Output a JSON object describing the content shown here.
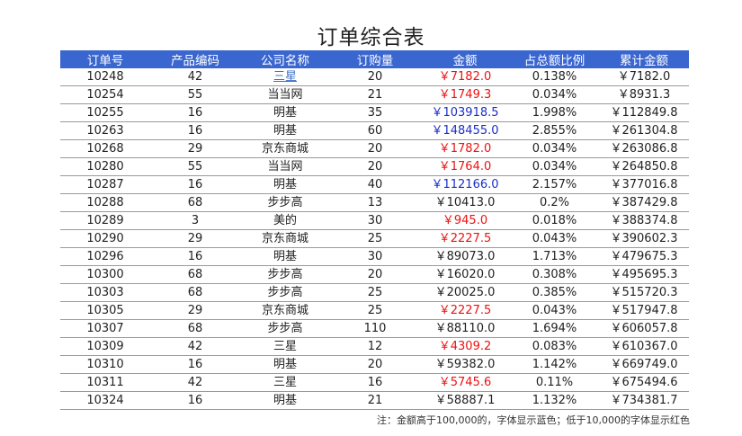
{
  "title": "订单综合表",
  "colors": {
    "header_bg": "#3a66cf",
    "low_amount": "#ee1111",
    "high_amount": "#1a2fc8",
    "link": "#3a6fc8"
  },
  "columns": [
    "订单号",
    "产品编码",
    "公司名称",
    "订购量",
    "金额",
    "占总额比例",
    "累计金额"
  ],
  "rows": [
    {
      "order": "10248",
      "code": "42",
      "company": "三星",
      "qty": "20",
      "amount": "￥7182.0",
      "amount_color": "red",
      "ratio": "0.138%",
      "cumulative": "￥7182.0",
      "link": true
    },
    {
      "order": "10254",
      "code": "55",
      "company": "当当网",
      "qty": "21",
      "amount": "￥1749.3",
      "amount_color": "red",
      "ratio": "0.034%",
      "cumulative": "￥8931.3"
    },
    {
      "order": "10255",
      "code": "16",
      "company": "明基",
      "qty": "35",
      "amount": "￥103918.5",
      "amount_color": "blue",
      "ratio": "1.998%",
      "cumulative": "￥112849.8"
    },
    {
      "order": "10263",
      "code": "16",
      "company": "明基",
      "qty": "60",
      "amount": "￥148455.0",
      "amount_color": "blue",
      "ratio": "2.855%",
      "cumulative": "￥261304.8"
    },
    {
      "order": "10268",
      "code": "29",
      "company": "京东商城",
      "qty": "20",
      "amount": "￥1782.0",
      "amount_color": "red",
      "ratio": "0.034%",
      "cumulative": "￥263086.8"
    },
    {
      "order": "10280",
      "code": "55",
      "company": "当当网",
      "qty": "20",
      "amount": "￥1764.0",
      "amount_color": "red",
      "ratio": "0.034%",
      "cumulative": "￥264850.8"
    },
    {
      "order": "10287",
      "code": "16",
      "company": "明基",
      "qty": "40",
      "amount": "￥112166.0",
      "amount_color": "blue",
      "ratio": "2.157%",
      "cumulative": "￥377016.8"
    },
    {
      "order": "10288",
      "code": "68",
      "company": "步步高",
      "qty": "13",
      "amount": "￥10413.0",
      "amount_color": "normal",
      "ratio": "0.2%",
      "cumulative": "￥387429.8"
    },
    {
      "order": "10289",
      "code": "3",
      "company": "美的",
      "qty": "30",
      "amount": "￥945.0",
      "amount_color": "red",
      "ratio": "0.018%",
      "cumulative": "￥388374.8"
    },
    {
      "order": "10290",
      "code": "29",
      "company": "京东商城",
      "qty": "25",
      "amount": "￥2227.5",
      "amount_color": "red",
      "ratio": "0.043%",
      "cumulative": "￥390602.3"
    },
    {
      "order": "10296",
      "code": "16",
      "company": "明基",
      "qty": "30",
      "amount": "￥89073.0",
      "amount_color": "normal",
      "ratio": "1.713%",
      "cumulative": "￥479675.3"
    },
    {
      "order": "10300",
      "code": "68",
      "company": "步步高",
      "qty": "20",
      "amount": "￥16020.0",
      "amount_color": "normal",
      "ratio": "0.308%",
      "cumulative": "￥495695.3"
    },
    {
      "order": "10303",
      "code": "68",
      "company": "步步高",
      "qty": "25",
      "amount": "￥20025.0",
      "amount_color": "normal",
      "ratio": "0.385%",
      "cumulative": "￥515720.3"
    },
    {
      "order": "10305",
      "code": "29",
      "company": "京东商城",
      "qty": "25",
      "amount": "￥2227.5",
      "amount_color": "red",
      "ratio": "0.043%",
      "cumulative": "￥517947.8"
    },
    {
      "order": "10307",
      "code": "68",
      "company": "步步高",
      "qty": "110",
      "amount": "￥88110.0",
      "amount_color": "normal",
      "ratio": "1.694%",
      "cumulative": "￥606057.8"
    },
    {
      "order": "10309",
      "code": "42",
      "company": "三星",
      "qty": "12",
      "amount": "￥4309.2",
      "amount_color": "red",
      "ratio": "0.083%",
      "cumulative": "￥610367.0"
    },
    {
      "order": "10310",
      "code": "16",
      "company": "明基",
      "qty": "20",
      "amount": "￥59382.0",
      "amount_color": "normal",
      "ratio": "1.142%",
      "cumulative": "￥669749.0"
    },
    {
      "order": "10311",
      "code": "42",
      "company": "三星",
      "qty": "16",
      "amount": "￥5745.6",
      "amount_color": "red",
      "ratio": "0.11%",
      "cumulative": "￥675494.6"
    },
    {
      "order": "10324",
      "code": "16",
      "company": "明基",
      "qty": "21",
      "amount": "￥58887.1",
      "amount_color": "normal",
      "ratio": "1.132%",
      "cumulative": "￥734381.7"
    }
  ],
  "note": "注：金额高于100,000的，字体显示蓝色；低于10,000的字体显示红色"
}
